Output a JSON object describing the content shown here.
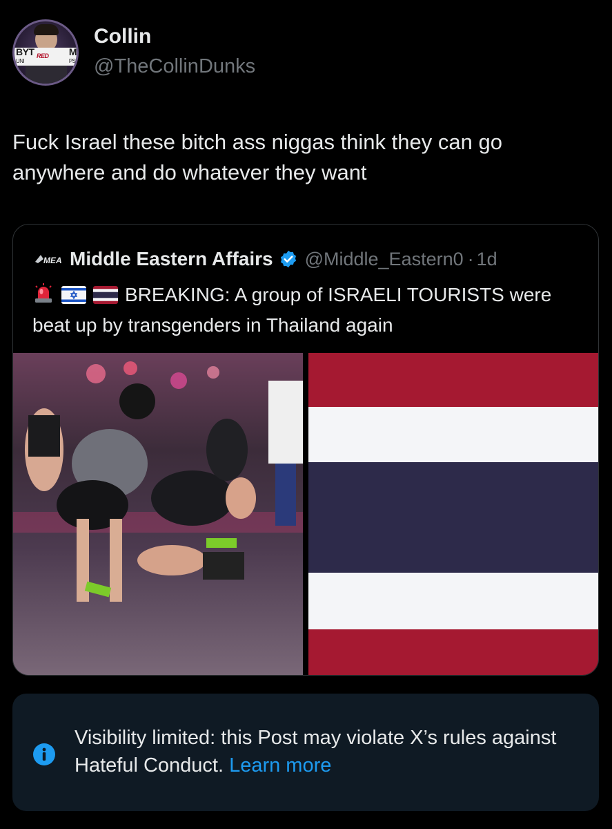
{
  "author": {
    "display_name": "Collin",
    "handle": "@TheCollinDunks",
    "avatar_text_left": "BYT",
    "avatar_text_left_sub": "UNI",
    "avatar_text_mid": "RED",
    "avatar_text_right": "M",
    "avatar_text_right_sub": "PS"
  },
  "tweet": {
    "text": "Fuck Israel these bitch ass niggas think they can go anywhere and do whatever they want"
  },
  "quoted": {
    "logo_text": "MEA",
    "display_name": "Middle Eastern Affairs",
    "verified_icon": "verified-badge-icon",
    "handle": "@Middle_Eastern0",
    "separator": "·",
    "time": "1d",
    "emojis": [
      "rotating-light-icon",
      "israel-flag-icon",
      "thailand-flag-icon"
    ],
    "text": "BREAKING: A group of ISRAELI TOURISTS were beat up by transgenders in Thailand again",
    "media": [
      "video-thumbnail",
      "thailand-flag-image"
    ]
  },
  "notice": {
    "icon": "info-icon",
    "text": "Visibility limited: this Post may violate X’s rules against Hateful Conduct.",
    "link": "Learn more"
  },
  "colors": {
    "background": "#000000",
    "text_primary": "#e7e9ea",
    "text_secondary": "#71767b",
    "accent_blue": "#1d9bf0",
    "notice_bg": "#0f1a24",
    "thai_red": "#a51931",
    "thai_white": "#f4f5f8",
    "thai_blue": "#2d2a4a"
  }
}
